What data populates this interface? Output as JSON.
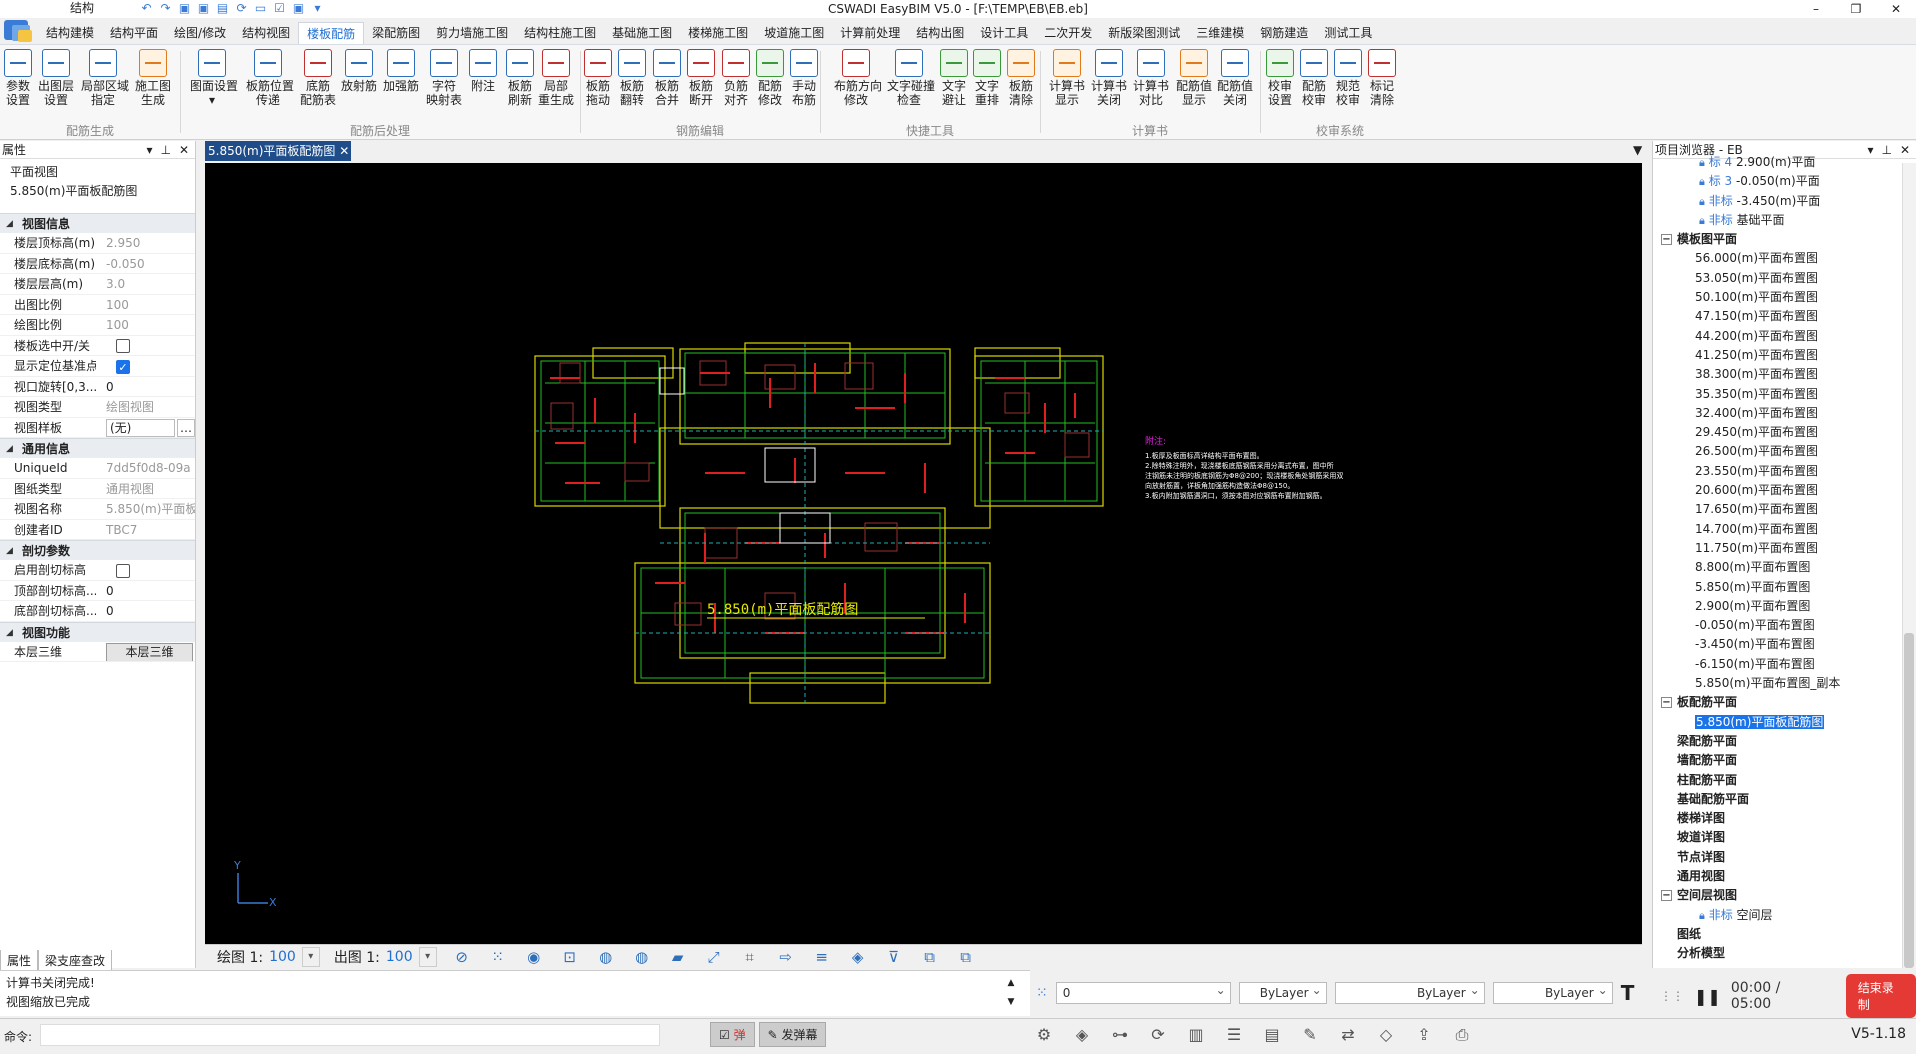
{
  "app": {
    "title": "CSWADI EasyBIM V5.0 - [F:\\TEMP\\EB\\EB.eb]",
    "qat_combo": "结构"
  },
  "tabs": [
    "结构建模",
    "结构平面",
    "绘图/修改",
    "结构视图",
    "楼板配筋",
    "梁配筋图",
    "剪力墙施工图",
    "结构柱施工图",
    "基础施工图",
    "楼梯施工图",
    "坡道施工图",
    "计算前处理",
    "结构出图",
    "设计工具",
    "二次开发",
    "新版梁图测试",
    "三维建模",
    "钢筋建造",
    "测试工具"
  ],
  "active_tab": 4,
  "ribbon": {
    "buttons": [
      {
        "label": "参数\n设置",
        "color": "blue"
      },
      {
        "label": "出图层\n设置",
        "color": "blue"
      },
      {
        "label": "局部区域\n指定",
        "color": "blue"
      },
      {
        "label": "施工图\n生成",
        "color": "orange"
      },
      {
        "label": "图面设置\n▾",
        "color": "blue"
      },
      {
        "label": "板筋位置\n传递",
        "color": "blue"
      },
      {
        "label": "底筋\n配筋表",
        "color": "red"
      },
      {
        "label": "放射筋",
        "color": "blue"
      },
      {
        "label": "加强筋",
        "color": "blue"
      },
      {
        "label": "字符\n映射表",
        "color": "blue"
      },
      {
        "label": "附注",
        "color": "blue"
      },
      {
        "label": "板筋\n刷新",
        "color": "blue"
      },
      {
        "label": "局部\n重生成",
        "color": "red"
      },
      {
        "label": "板筋\n拖动",
        "color": "red"
      },
      {
        "label": "板筋\n翻转",
        "color": "blue"
      },
      {
        "label": "板筋\n合并",
        "color": "blue"
      },
      {
        "label": "板筋\n断开",
        "color": "red"
      },
      {
        "label": "负筋\n对齐",
        "color": "red"
      },
      {
        "label": "配筋\n修改",
        "color": "green"
      },
      {
        "label": "手动\n布筋",
        "color": "blue"
      },
      {
        "label": "布筋方向\n修改",
        "color": "red"
      },
      {
        "label": "文字碰撞\n检查",
        "color": "blue"
      },
      {
        "label": "文字\n避让",
        "color": "green"
      },
      {
        "label": "文字\n重排",
        "color": "green"
      },
      {
        "label": "板筋\n清除",
        "color": "orange"
      },
      {
        "label": "计算书\n显示",
        "color": "orange"
      },
      {
        "label": "计算书\n关闭",
        "color": "blue"
      },
      {
        "label": "计算书\n对比",
        "color": "blue"
      },
      {
        "label": "配筋值\n显示",
        "color": "orange"
      },
      {
        "label": "配筋值\n关闭",
        "color": "blue"
      },
      {
        "label": "校审\n设置",
        "color": "green"
      },
      {
        "label": "配筋\n校审",
        "color": "blue"
      },
      {
        "label": "规范\n校审",
        "color": "blue"
      },
      {
        "label": "标记\n清除",
        "color": "red"
      }
    ],
    "groups": [
      "配筋生成",
      "配筋后处理",
      "钢筋编辑",
      "快捷工具",
      "计算书",
      "校审系统"
    ]
  },
  "left_panel": {
    "title": "属性",
    "header_line1": "平面视图",
    "header_line2": "5.850(m)平面板配筋图",
    "sections": {
      "view_info": "视图信息",
      "general_info": "通用信息",
      "cut_params": "剖切参数",
      "view_func": "视图功能"
    },
    "props": {
      "top_elev_k": "楼层顶标高(m)",
      "top_elev_v": "2.950",
      "bot_elev_k": "楼层底标高(m)",
      "bot_elev_v": "-0.050",
      "height_k": "楼层层高(m)",
      "height_v": "3.0",
      "out_scale_k": "出图比例",
      "out_scale_v": "100",
      "draw_scale_k": "绘图比例",
      "draw_scale_v": "100",
      "select_k": "楼板选中开/关",
      "anchor_k": "显示定位基准点",
      "rotate_k": "视口旋转[0,3...",
      "rotate_v": "0",
      "vtype_k": "视图类型",
      "vtype_v": "绘图视图",
      "vtemplate_k": "视图样板",
      "vtemplate_v": "(无)",
      "uid_k": "UniqueId",
      "uid_v": "7dd5f0d8-09a",
      "dtype_k": "图纸类型",
      "dtype_v": "通用视图",
      "vname_k": "视图名称",
      "vname_v": "5.850(m)平面板",
      "creator_k": "创建者ID",
      "creator_v": "TBC7",
      "cut_enable_k": "启用剖切标高",
      "top_cut_k": "顶部剖切标高...",
      "top_cut_v": "0",
      "bot_cut_k": "底部剖切标高...",
      "bot_cut_v": "0",
      "floor3d_k": "本层三维",
      "floor3d_btn": "本层三维"
    },
    "bottom_tabs": [
      "属性",
      "梁支座查改"
    ]
  },
  "document": {
    "tab_label": "5.850(m)平面板配筋图",
    "drawing_title": "5.850(m)平面板配筋图",
    "notes_title": "附注:",
    "notes": [
      "1.板厚及板面标高详结构平面布置图。",
      "2.除特殊注明外，现浇楼板底筋钢筋采用分离式布置，图中所",
      "  注钢筋未注明的板底钢筋为Φ8@200；现浇楼板角处钢筋采用双",
      "  向放射筋置，详板角加强筋构造做法Φ8@150。",
      "3.板内附加钢筋遇洞口，须按本图对应钢筋布置附加钢筋。"
    ],
    "axis_x": "X",
    "axis_y": "Y",
    "bottom": {
      "draw_label": "绘图 1:",
      "draw_scale": "100",
      "out_label": "出图 1:",
      "out_scale": "100"
    }
  },
  "right_panel": {
    "title": "项目浏览器 - EB",
    "top_items": [
      {
        "tag": "标 4",
        "name": "2.900(m)平面"
      },
      {
        "tag": "标 3",
        "name": "-0.050(m)平面"
      },
      {
        "tag": "非标",
        "name": "-3.450(m)平面"
      },
      {
        "tag": "非标",
        "name": "基础平面"
      }
    ],
    "formwork_group": "模板图平面",
    "formwork_items": [
      "56.000(m)平面布置图",
      "53.050(m)平面布置图",
      "50.100(m)平面布置图",
      "47.150(m)平面布置图",
      "44.200(m)平面布置图",
      "41.250(m)平面布置图",
      "38.300(m)平面布置图",
      "35.350(m)平面布置图",
      "32.400(m)平面布置图",
      "29.450(m)平面布置图",
      "26.500(m)平面布置图",
      "23.550(m)平面布置图",
      "20.600(m)平面布置图",
      "17.650(m)平面布置图",
      "14.700(m)平面布置图",
      "11.750(m)平面布置图",
      "8.800(m)平面布置图",
      "5.850(m)平面布置图",
      "2.900(m)平面布置图",
      "-0.050(m)平面布置图",
      "-3.450(m)平面布置图",
      "-6.150(m)平面布置图",
      "5.850(m)平面布置图_副本"
    ],
    "slab_group": "板配筋平面",
    "slab_selected": "5.850(m)平面板配筋图",
    "other_groups": [
      "梁配筋平面",
      "墙配筋平面",
      "柱配筋平面",
      "基础配筋平面",
      "楼梯详图",
      "坡道详图",
      "节点详图",
      "通用视图"
    ],
    "space_group": "空间层视图",
    "space_item_tag": "非标",
    "space_item": "空间层",
    "tail_groups": [
      "图纸",
      "分析模型"
    ]
  },
  "messages": [
    "计算书关闭完成!",
    "视图缩放已完成"
  ],
  "prop_bar": {
    "layer": "0",
    "color": "ByLayer",
    "linetype": "ByLayer",
    "lineweight": "ByLayer"
  },
  "recorder": {
    "time": "00:00 / 05:00",
    "stop_label": "结束录制"
  },
  "status": {
    "cmd_label": "命令:",
    "btn1": "弹",
    "btn2": "发弹幕",
    "version": "V5-1.18"
  }
}
